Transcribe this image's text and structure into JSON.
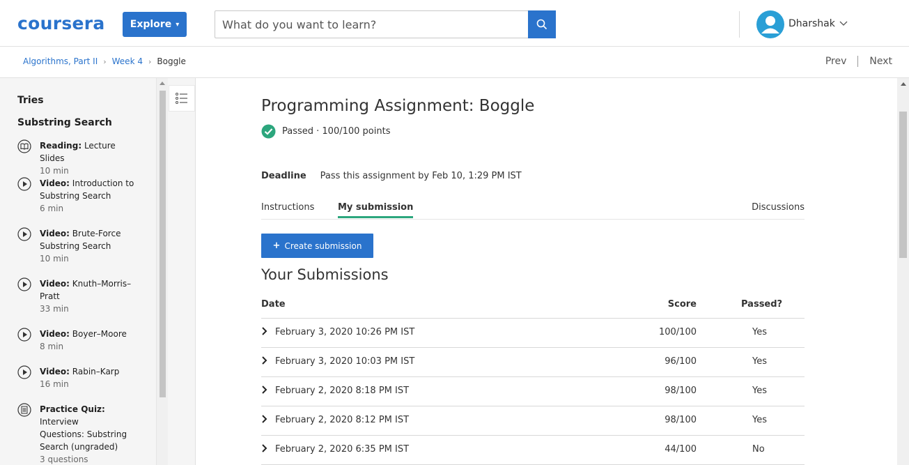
{
  "header": {
    "logo": "coursera",
    "explore_label": "Explore",
    "search_placeholder": "What do you want to learn?",
    "username": "Dharshak"
  },
  "breadcrumb": {
    "items": [
      "Algorithms, Part II",
      "Week 4"
    ],
    "current": "Boggle"
  },
  "nav": {
    "prev": "Prev",
    "next": "Next"
  },
  "sidebar": {
    "headings": [
      "Tries",
      "Substring Search"
    ],
    "items": [
      {
        "icon": "book-icon",
        "type": "Reading:",
        "title": "Lecture Slides",
        "title2": "",
        "title3": "",
        "meta": "10 min"
      },
      {
        "icon": "play-icon",
        "type": "Video:",
        "title": "Introduction to",
        "title2": "Substring Search",
        "title3": "",
        "meta": "6 min"
      },
      {
        "icon": "play-icon",
        "type": "Video:",
        "title": "Brute-Force",
        "title2": "Substring Search",
        "title3": "",
        "meta": "10 min"
      },
      {
        "icon": "play-icon",
        "type": "Video:",
        "title": "Knuth–Morris–",
        "title2": "Pratt",
        "title3": "",
        "meta": "33 min"
      },
      {
        "icon": "play-icon",
        "type": "Video:",
        "title": "Boyer–Moore",
        "title2": "",
        "title3": "",
        "meta": "8 min"
      },
      {
        "icon": "play-icon",
        "type": "Video:",
        "title": "Rabin–Karp",
        "title2": "",
        "title3": "",
        "meta": "16 min"
      },
      {
        "icon": "quiz-icon",
        "type": "Practice Quiz:",
        "title": "Interview",
        "title2": "Questions: Substring",
        "title3": "Search (ungraded)",
        "meta": "3 questions"
      }
    ]
  },
  "main": {
    "title": "Programming Assignment: Boggle",
    "status": "Passed · 100/100 points",
    "deadline_label": "Deadline",
    "deadline_text": "Pass this assignment by Feb 10, 1:29 PM IST",
    "tabs": [
      "Instructions",
      "My submission"
    ],
    "tab_right": "Discussions",
    "create_button": "Create submission",
    "submissions_heading": "Your Submissions",
    "columns": {
      "date": "Date",
      "score": "Score",
      "passed": "Passed?"
    },
    "rows": [
      {
        "date": "February 3, 2020 10:26 PM IST",
        "score": "100/100",
        "passed": "Yes"
      },
      {
        "date": "February 3, 2020 10:03 PM IST",
        "score": "96/100",
        "passed": "Yes"
      },
      {
        "date": "February 2, 2020 8:18 PM IST",
        "score": "98/100",
        "passed": "Yes"
      },
      {
        "date": "February 2, 2020 8:12 PM IST",
        "score": "98/100",
        "passed": "Yes"
      },
      {
        "date": "February 2, 2020 6:35 PM IST",
        "score": "44/100",
        "passed": "No"
      }
    ]
  },
  "colors": {
    "brand": "#2a73cc",
    "success": "#2ca67d"
  }
}
